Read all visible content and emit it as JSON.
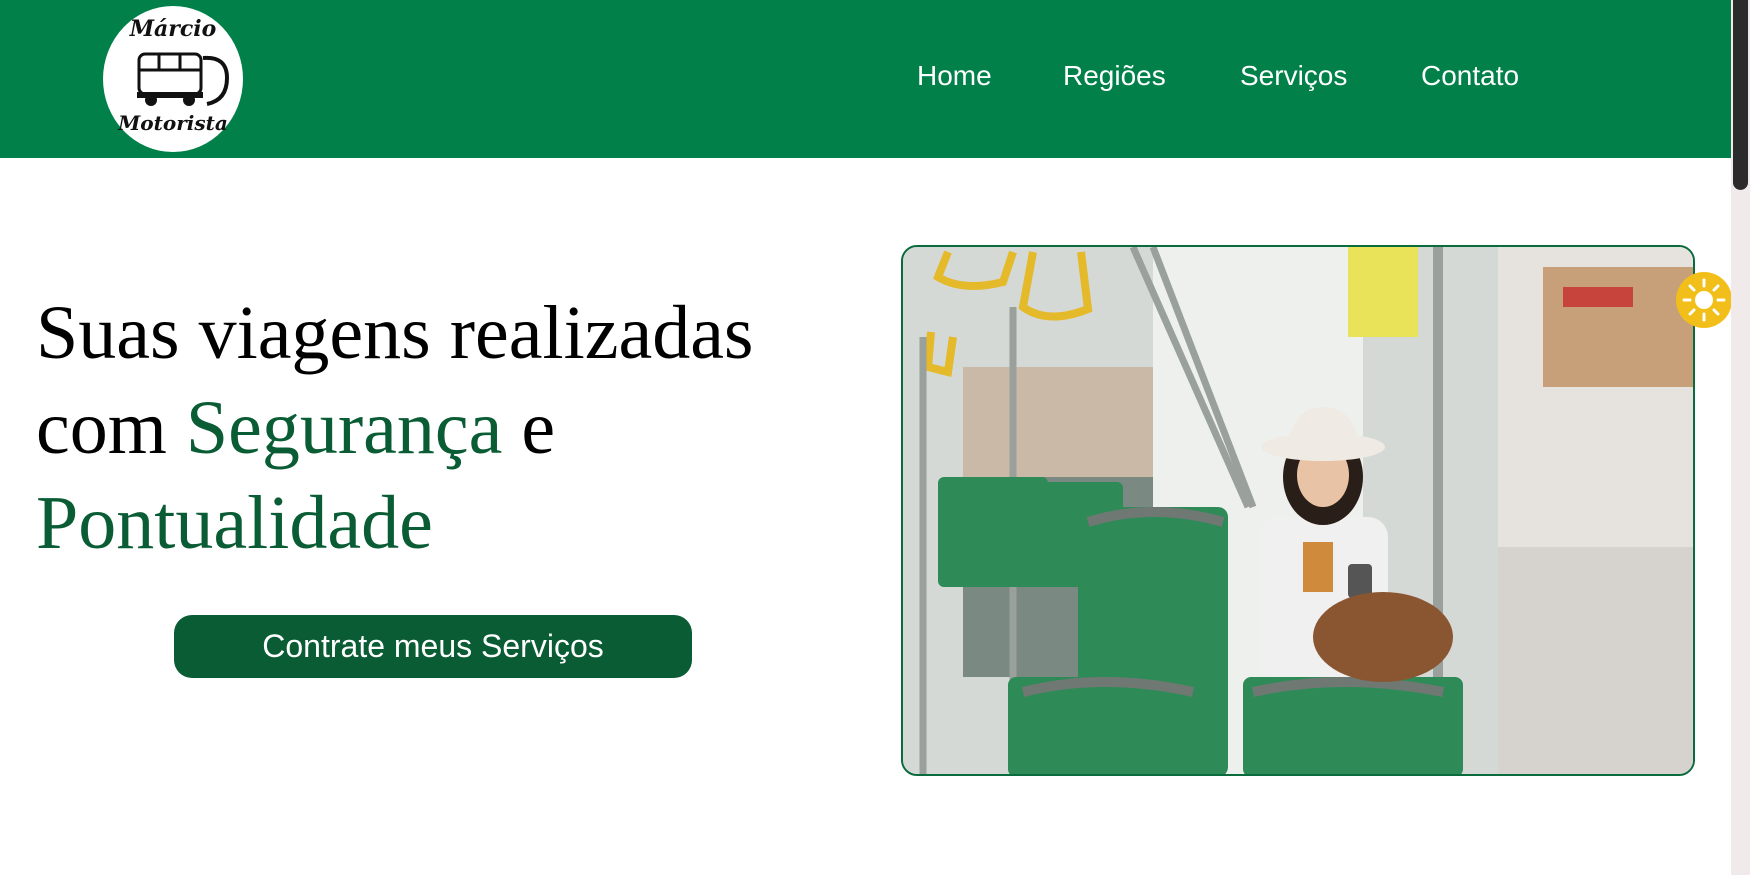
{
  "brand": {
    "logo_line1": "Márcio",
    "logo_line2": "Motorista"
  },
  "nav": {
    "items": [
      {
        "label": "Home"
      },
      {
        "label": "Regiões"
      },
      {
        "label": "Serviços"
      },
      {
        "label": "Contato"
      }
    ]
  },
  "hero": {
    "title_part1": "Suas viagens realizadas com ",
    "title_highlight1": "Segurança",
    "title_part2": " e ",
    "title_highlight2": "Pontualidade",
    "cta_label": "Contrate meus Serviços"
  },
  "theme_toggle": {
    "icon": "sun-icon"
  },
  "colors": {
    "header_green": "#018149",
    "accent_green": "#0a5c34",
    "toggle_yellow": "#f2bf1a"
  }
}
